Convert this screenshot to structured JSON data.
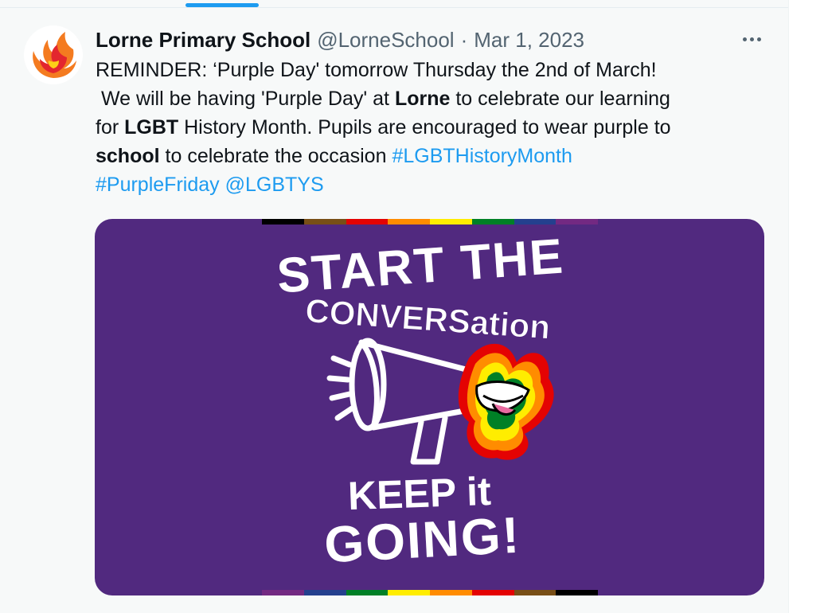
{
  "tweet": {
    "author": {
      "name": "Lorne Primary School",
      "handle": "@LorneSchool",
      "avatar_icon": "phoenix-logo-icon"
    },
    "separator": "·",
    "date": "Mar 1, 2023",
    "more_icon": "more-options-icon",
    "text": {
      "line1": "REMINDER: ‘Purple Day' tomorrow Thursday the 2nd of March!",
      "line2_a": " We will be having 'Purple Day' at ",
      "line2_bold": "Lorne",
      "line2_b": " to celebrate our learning",
      "line3_a": "for ",
      "line3_bold": "LGBT",
      "line3_b": " History Month. Pupils are encouraged to wear purple to",
      "line4_bold": "school",
      "line4_a": " to celebrate the occasion ",
      "hashtag1": "#LGBTHistoryMonth",
      "hashtag2": "#PurpleFriday",
      "space": " ",
      "mention": "@LGBTYS"
    },
    "media": {
      "background": "#51297f",
      "headline_1": "START THE",
      "headline_2": "CONVERSation",
      "footer_1": "KEEP it",
      "footer_2": "GOING!",
      "flag_colors": [
        "#000000",
        "#784f17",
        "#e40303",
        "#ff8c00",
        "#ffed00",
        "#008026",
        "#24408e",
        "#732982"
      ],
      "icons": [
        "megaphone-icon",
        "rainbow-mouth-icon"
      ]
    },
    "accent_color": "#1d9bf0"
  }
}
